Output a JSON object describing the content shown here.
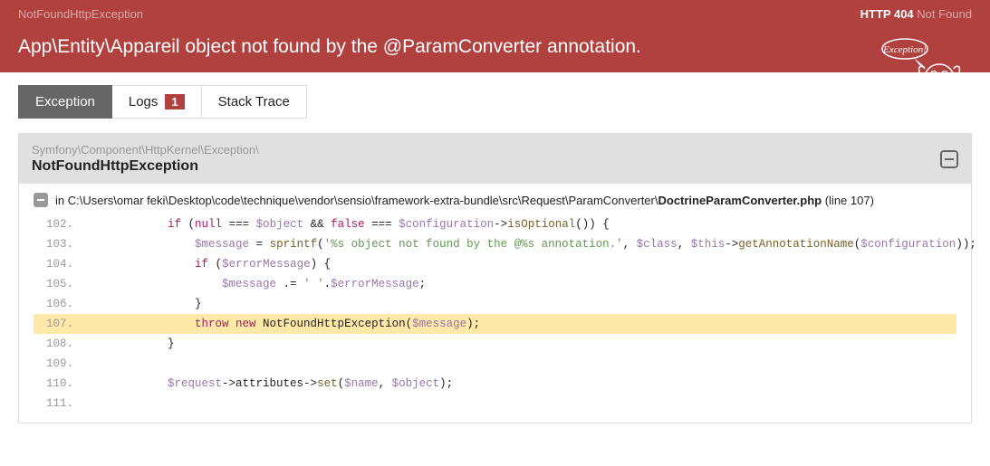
{
  "header": {
    "exception_short": "NotFoundHttpException",
    "http_code": "HTTP 404",
    "http_text": "Not Found",
    "message": "App\\Entity\\Appareil object not found by the @ParamConverter annotation.",
    "ghost_text": "Exception!"
  },
  "tabs": {
    "exception": "Exception",
    "logs": "Logs",
    "logs_count": "1",
    "stack_trace": "Stack Trace"
  },
  "panel": {
    "namespace": "Symfony\\Component\\HttpKernel\\Exception\\",
    "class_name": "NotFoundHttpException"
  },
  "trace": {
    "prefix": "in",
    "path_before": "C:\\Users\\omar feki\\Desktop\\code\\technique\\vendor\\sensio\\framework-extra-bundle\\src\\Request\\ParamConverter\\",
    "filename": "DoctrineParamConverter.php",
    "line_info": "(line 107)",
    "highlighted_line": "107",
    "lines": [
      {
        "n": "102.",
        "html": "            <span class='k'>if</span> (<span class='k'>null</span> === <span class='v'>$object</span> && <span class='k'>false</span> === <span class='v'>$configuration</span>-&gt;<span class='f'>isOptional</span>()) {"
      },
      {
        "n": "103.",
        "html": "                <span class='v'>$message</span> = <span class='f'>sprintf</span>(<span class='s'>'%s object not found by the @%s annotation.'</span>, <span class='v'>$class</span>, <span class='v'>$this</span>-&gt;<span class='f'>getAnnotationName</span>(<span class='v'>$configuration</span>));"
      },
      {
        "n": "104.",
        "html": "                <span class='k'>if</span> (<span class='v'>$errorMessage</span>) {"
      },
      {
        "n": "105.",
        "html": "                    <span class='v'>$message</span> .= <span class='s'>' '</span>.<span class='v'>$errorMessage</span>;"
      },
      {
        "n": "106.",
        "html": "                }"
      },
      {
        "n": "107.",
        "html": "                <span class='k'>throw new</span> NotFoundHttpException(<span class='v'>$message</span>);"
      },
      {
        "n": "108.",
        "html": "            }"
      },
      {
        "n": "109.",
        "html": ""
      },
      {
        "n": "110.",
        "html": "            <span class='v'>$request</span>-&gt;attributes-&gt;<span class='f'>set</span>(<span class='v'>$name</span>, <span class='v'>$object</span>);"
      },
      {
        "n": "111.",
        "html": ""
      }
    ]
  }
}
